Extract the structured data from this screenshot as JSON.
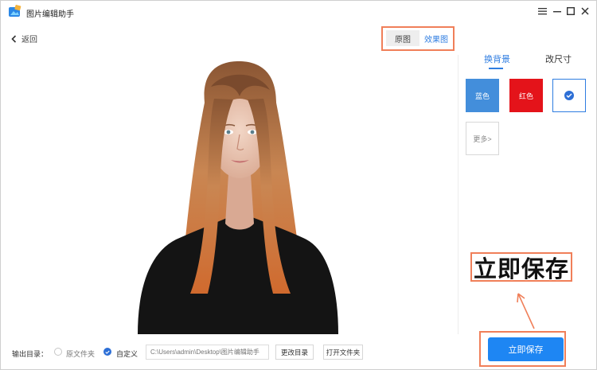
{
  "app": {
    "title": "图片编辑助手"
  },
  "nav": {
    "back_label": "返回"
  },
  "view_toggle": {
    "original_label": "原图",
    "effect_label": "效果图",
    "active": "效果图"
  },
  "panel": {
    "tabs": [
      {
        "label": "换背景",
        "active": true
      },
      {
        "label": "改尺寸",
        "active": false
      }
    ],
    "colors": [
      {
        "label": "蓝色",
        "color": "#438edb"
      },
      {
        "label": "红色",
        "color": "#e4131a"
      },
      {
        "label": "",
        "color": "#ffffff",
        "selected": true
      }
    ],
    "more_label": "更多>"
  },
  "output": {
    "label": "输出目录：",
    "option_original": "原文件夹",
    "option_custom": "自定义",
    "selected": "自定义",
    "path_placeholder": "C:\\Users\\admin\\Desktop\\图片编辑助手",
    "change_dir_label": "更改目录",
    "open_folder_label": "打开文件夹"
  },
  "save_button_label": "立即保存",
  "annotation": {
    "callout_text": "立即保存"
  },
  "colors": {
    "accent": "#2f7de1",
    "save_button": "#1e86f3",
    "highlight_frame": "#f07f59"
  }
}
